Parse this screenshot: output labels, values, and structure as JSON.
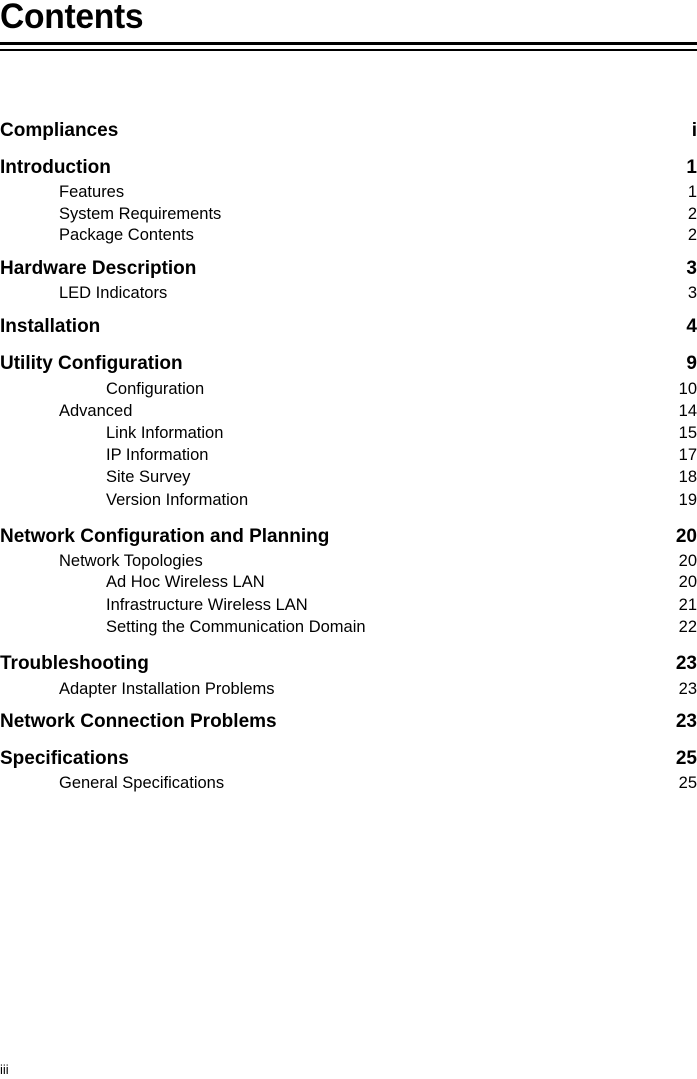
{
  "page": {
    "title": "Contents",
    "footer_page_number": "iii"
  },
  "toc": [
    {
      "level": 0,
      "label": "Compliances",
      "page": "i"
    },
    {
      "level": 0,
      "label": "Introduction",
      "page": "1"
    },
    {
      "level": 1,
      "label": "Features",
      "page": "1"
    },
    {
      "level": 1,
      "label": "System Requirements",
      "page": "2"
    },
    {
      "level": 1,
      "label": "Package Contents",
      "page": "2"
    },
    {
      "level": 0,
      "label": "Hardware Description",
      "page": "3"
    },
    {
      "level": 1,
      "label": "LED Indicators",
      "page": "3"
    },
    {
      "level": 0,
      "label": "Installation",
      "page": "4"
    },
    {
      "level": 0,
      "label": "Utility Configuration",
      "page": "9"
    },
    {
      "level": 2,
      "label": "Configuration",
      "page": "10"
    },
    {
      "level": 1,
      "label": "Advanced",
      "page": "14"
    },
    {
      "level": 2,
      "label": "Link Information",
      "page": "15"
    },
    {
      "level": 2,
      "label": "IP Information",
      "page": "17"
    },
    {
      "level": 2,
      "label": "Site Survey",
      "page": "18"
    },
    {
      "level": 2,
      "label": "Version Information",
      "page": "19"
    },
    {
      "level": 0,
      "label": "Network Configuration and Planning",
      "page": "20"
    },
    {
      "level": 1,
      "label": "Network Topologies",
      "page": "20"
    },
    {
      "level": 2,
      "label": "Ad Hoc Wireless LAN",
      "page": "20"
    },
    {
      "level": 2,
      "label": "Infrastructure Wireless LAN",
      "page": "21"
    },
    {
      "level": 2,
      "label": "Setting the Communication Domain",
      "page": "22"
    },
    {
      "level": 0,
      "label": "Troubleshooting",
      "page": "23"
    },
    {
      "level": 1,
      "label": "Adapter Installation Problems",
      "page": "23"
    },
    {
      "level": 0,
      "label": "Network Connection Problems",
      "page": "23"
    },
    {
      "level": 0,
      "label": "Specifications",
      "page": "25"
    },
    {
      "level": 1,
      "label": "General Specifications",
      "page": "25"
    }
  ]
}
